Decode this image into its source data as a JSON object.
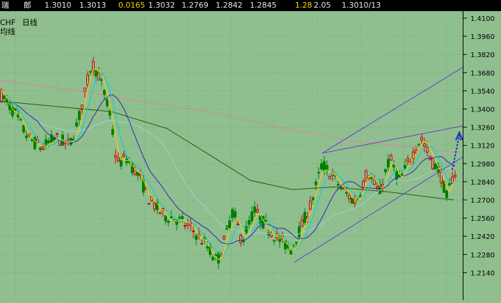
{
  "quote_bar": {
    "symbol_partial": "瑞",
    "field_partial": "郎",
    "open": "1.3010",
    "prev_close": "1.3013",
    "change": "0.0165",
    "high_value": "1.3032",
    "low_value": "1.2769",
    "v1": "1.2842",
    "v2": "1.2845",
    "ratio": "1.28",
    "pct": "2.05",
    "date": "1.3010/13"
  },
  "pane": {
    "symbol": "CHF",
    "period": "日线",
    "period_sub": "均线"
  },
  "axis": {
    "ticks": [
      "1.4100",
      "1.3960",
      "1.3820",
      "1.3680",
      "1.3540",
      "1.3400",
      "1.3260",
      "1.3120",
      "1.2980",
      "1.2840",
      "1.2700",
      "1.2560",
      "1.2420",
      "1.2280",
      "1.2140"
    ]
  },
  "colors": {
    "background": "#8fbf8f",
    "grid": "#6f9f6f",
    "candle_up": "#d40000",
    "candle_down": "#008000",
    "ma_fast": "#ffd400",
    "ma_cyan": "#00d0e0",
    "ma_blue": "#3020c0",
    "ma_olive": "#2a5a00",
    "ma_pink": "#e080a0",
    "ma_light": "#a0d0d0",
    "trendline": "#6a3ad0",
    "arrow": "#1a2fc0"
  }
}
